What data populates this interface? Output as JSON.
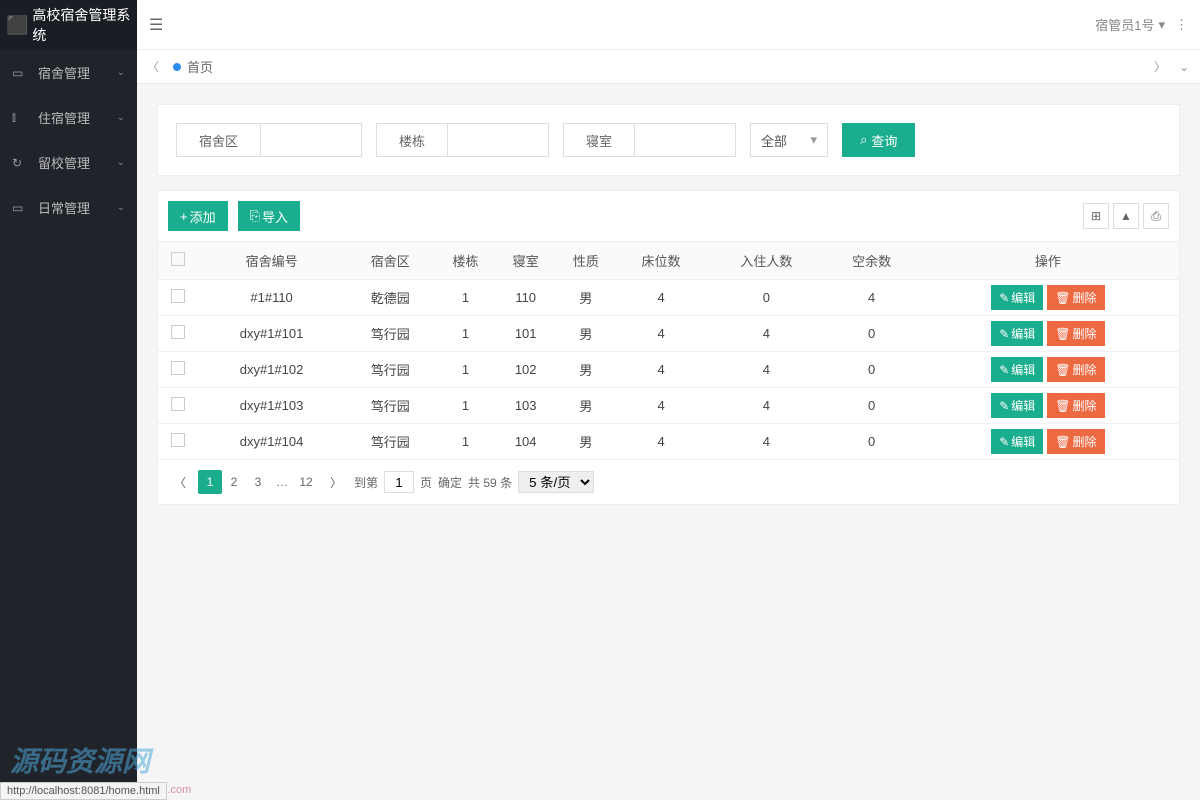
{
  "app_title": "高校宿舍管理系统",
  "sidebar": {
    "items": [
      {
        "icon": "▭",
        "label": "宿舍管理"
      },
      {
        "icon": "⫾",
        "label": "住宿管理"
      },
      {
        "icon": "↻",
        "label": "留校管理"
      },
      {
        "icon": "▭",
        "label": "日常管理"
      }
    ]
  },
  "header": {
    "user": "宿管员1号"
  },
  "tabs": {
    "home": "首页"
  },
  "search": {
    "area_label": "宿舍区",
    "building_label": "楼栋",
    "room_label": "寝室",
    "select_all": "全部",
    "query_label": "查询"
  },
  "toolbar": {
    "add_label": "添加",
    "import_label": "导入"
  },
  "table": {
    "columns": [
      "宿舍编号",
      "宿舍区",
      "楼栋",
      "寝室",
      "性质",
      "床位数",
      "入住人数",
      "空余数",
      "操作"
    ],
    "edit_label": "编辑",
    "delete_label": "删除",
    "rows": [
      {
        "id": "#1#110",
        "area": "乾德园",
        "building": "1",
        "room": "110",
        "nature": "男",
        "beds": "4",
        "occupied": "0",
        "free": "4"
      },
      {
        "id": "dxy#1#101",
        "area": "笃行园",
        "building": "1",
        "room": "101",
        "nature": "男",
        "beds": "4",
        "occupied": "4",
        "free": "0"
      },
      {
        "id": "dxy#1#102",
        "area": "笃行园",
        "building": "1",
        "room": "102",
        "nature": "男",
        "beds": "4",
        "occupied": "4",
        "free": "0"
      },
      {
        "id": "dxy#1#103",
        "area": "笃行园",
        "building": "1",
        "room": "103",
        "nature": "男",
        "beds": "4",
        "occupied": "4",
        "free": "0"
      },
      {
        "id": "dxy#1#104",
        "area": "笃行园",
        "building": "1",
        "room": "104",
        "nature": "男",
        "beds": "4",
        "occupied": "4",
        "free": "0"
      }
    ]
  },
  "pagination": {
    "pages": [
      "1",
      "2",
      "3",
      "…",
      "12"
    ],
    "goto_label": "到第",
    "goto_value": "1",
    "page_suffix": "页",
    "confirm": "确定",
    "total": "共 59 条",
    "per_page": "5 条/页"
  },
  "watermark": "源码资源网",
  "status_url": "http://localhost:8081/home.html",
  "footer_link": "http://www.net188.com"
}
